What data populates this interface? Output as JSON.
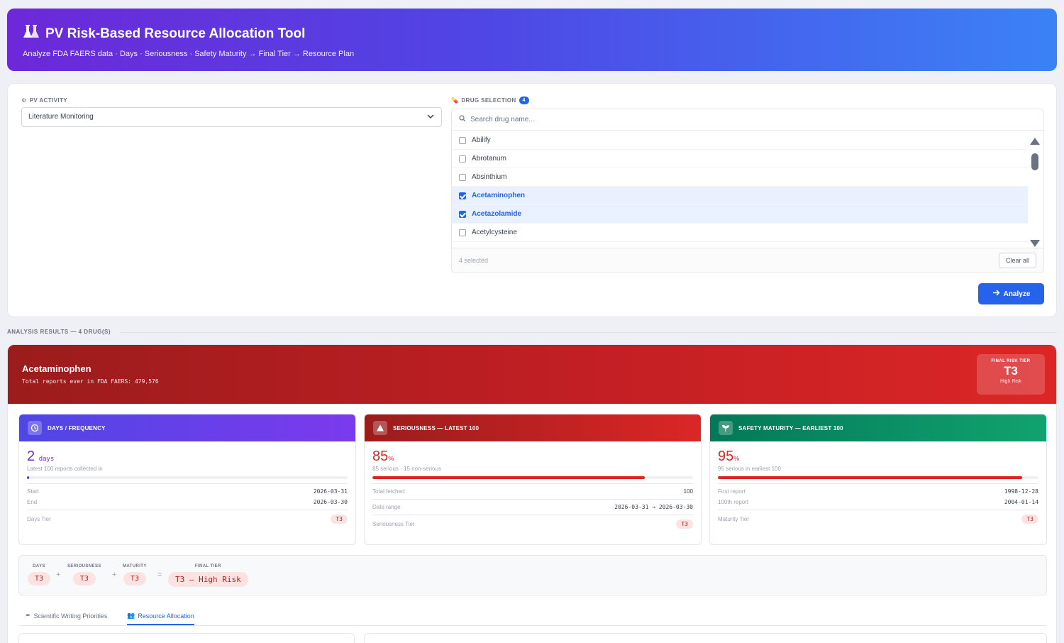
{
  "header": {
    "title": "PV Risk-Based Resource Allocation Tool",
    "subtitle": "Analyze FDA FAERS data · Days · Seriousness · Safety Maturity → Final Tier → Resource Plan"
  },
  "config": {
    "pv_activity_label": "PV ACTIVITY",
    "pv_activity_value": "Literature Monitoring",
    "drug_selection_label": "DRUG SELECTION",
    "drug_selection_count": "4",
    "search_placeholder": "Search drug name...",
    "drugs": [
      {
        "name": "Abilify",
        "checked": false
      },
      {
        "name": "Abrotanum",
        "checked": false
      },
      {
        "name": "Absinthium",
        "checked": false
      },
      {
        "name": "Acetaminophen",
        "checked": true
      },
      {
        "name": "Acetazolamide",
        "checked": true
      },
      {
        "name": "Acetylcysteine",
        "checked": false
      }
    ],
    "selected_text": "4 selected",
    "clear_label": "Clear all",
    "analyze_label": "Analyze"
  },
  "results": {
    "section_label": "ANALYSIS RESULTS — 4 DRUG(S)",
    "drug_name": "Acetaminophen",
    "total_reports": "Total reports ever in FDA FAERS: 479,576",
    "final_box": {
      "label": "FINAL RISK TIER",
      "tier": "T3",
      "risk": "High Risk"
    },
    "days": {
      "title": "DAYS / FREQUENCY",
      "value": "2",
      "unit": "days",
      "caption": "Latest 100 reports collected in",
      "progress": 0.005,
      "start_label": "Start",
      "start_value": "2026-03-31",
      "end_label": "End",
      "end_value": "2026-03-30",
      "tier_label": "Days Tier",
      "tier_value": "T3"
    },
    "seriousness": {
      "title": "SERIOUSNESS — LATEST 100",
      "value": "85",
      "unit": "%",
      "caption": "85 serious · 15 non-serious",
      "progress": 0.85,
      "fetched_label": "Total fetched",
      "fetched_value": "100",
      "range_label": "Date range",
      "range_value": "2026-03-31 → 2026-03-30",
      "tier_label": "Seriousness Tier",
      "tier_value": "T3"
    },
    "maturity": {
      "title": "SAFETY MATURITY — EARLIEST 100",
      "value": "95",
      "unit": "%",
      "caption": "95 serious in earliest 100",
      "progress": 0.95,
      "first_label": "First report",
      "first_value": "1998-12-28",
      "hundredth_label": "100th report",
      "hundredth_value": "2004-01-14",
      "tier_label": "Maturity Tier",
      "tier_value": "T3"
    },
    "formula": {
      "days_h": "DAYS",
      "days_v": "T3",
      "ser_h": "SERIOUSNESS",
      "ser_v": "T3",
      "mat_h": "MATURITY",
      "mat_v": "T3",
      "final_h": "FINAL TIER",
      "final_v": "T3 — High Risk",
      "plus": "+",
      "equals": "="
    },
    "tabs": [
      {
        "label": "Scientific Writing Priorities",
        "active": false
      },
      {
        "label": "Resource Allocation",
        "active": true
      }
    ]
  },
  "colors": {
    "accent": "#2563eb",
    "danger": "#dc2626",
    "purple": "#6d28d9",
    "green": "#059669"
  }
}
